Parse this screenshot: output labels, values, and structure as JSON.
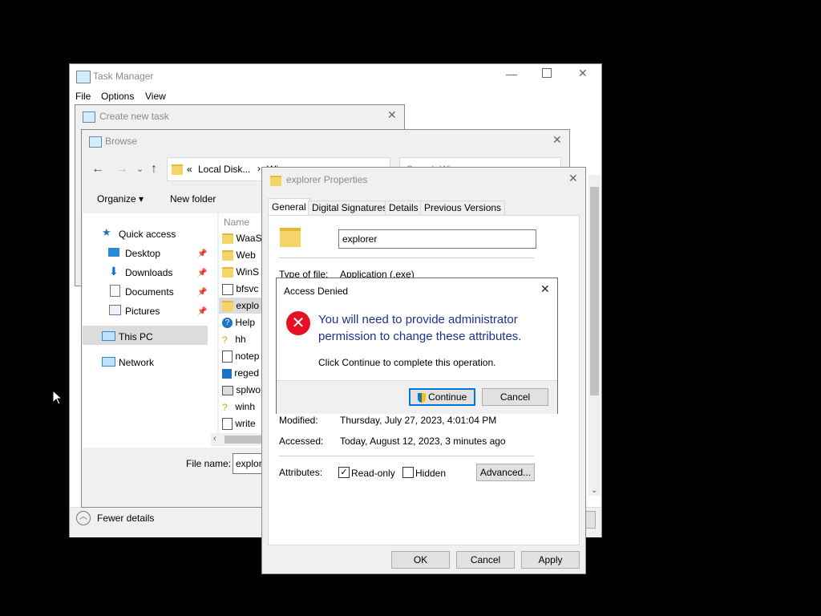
{
  "task_manager": {
    "title": "Task Manager",
    "menu": [
      "File",
      "Options",
      "View"
    ],
    "fewer_details": "Fewer details"
  },
  "create_task": {
    "title": "Create new task"
  },
  "browse": {
    "title": "Browse",
    "breadcrumb_prefix": "«",
    "breadcrumb_1": "Local Disk...",
    "breadcrumb_sep": "›",
    "breadcrumb_2": "Wi...",
    "search_placeholder": "Search Wi...",
    "organize": "Organize",
    "new_folder": "New folder",
    "col_name": "Name",
    "nav": {
      "quick_access": "Quick access",
      "desktop": "Desktop",
      "downloads": "Downloads",
      "documents": "Documents",
      "pictures": "Pictures",
      "this_pc": "This PC",
      "network": "Network"
    },
    "files": [
      "WaaS",
      "Web",
      "WinS",
      "bfsvc",
      "explo",
      "Help",
      "hh",
      "notep",
      "reged",
      "splwo",
      "winh",
      "write"
    ],
    "file_name_label": "File name:",
    "file_name_value": "explor"
  },
  "props": {
    "title": "explorer Properties",
    "tabs": [
      "General",
      "Digital Signatures",
      "Details",
      "Previous Versions"
    ],
    "name_value": "explorer",
    "type_label": "Type of file:",
    "type_value": "Application (.exe)",
    "modified_label": "Modified:",
    "modified_value": "Thursday, July 27, 2023, 4:01:04 PM",
    "accessed_label": "Accessed:",
    "accessed_value": "Today, August 12, 2023, 3 minutes ago",
    "attributes_label": "Attributes:",
    "readonly_label": "Read-only",
    "hidden_label": "Hidden",
    "advanced_label": "Advanced...",
    "ok": "OK",
    "cancel": "Cancel",
    "apply": "Apply"
  },
  "access_denied": {
    "title": "Access Denied",
    "message": "You will need to provide administrator permission to change these attributes.",
    "sub": "Click Continue to complete this operation.",
    "continue": "Continue",
    "cancel": "Cancel"
  },
  "colors": {
    "accent": "#0078d7",
    "error": "#e81123",
    "message": "#1e3287"
  }
}
